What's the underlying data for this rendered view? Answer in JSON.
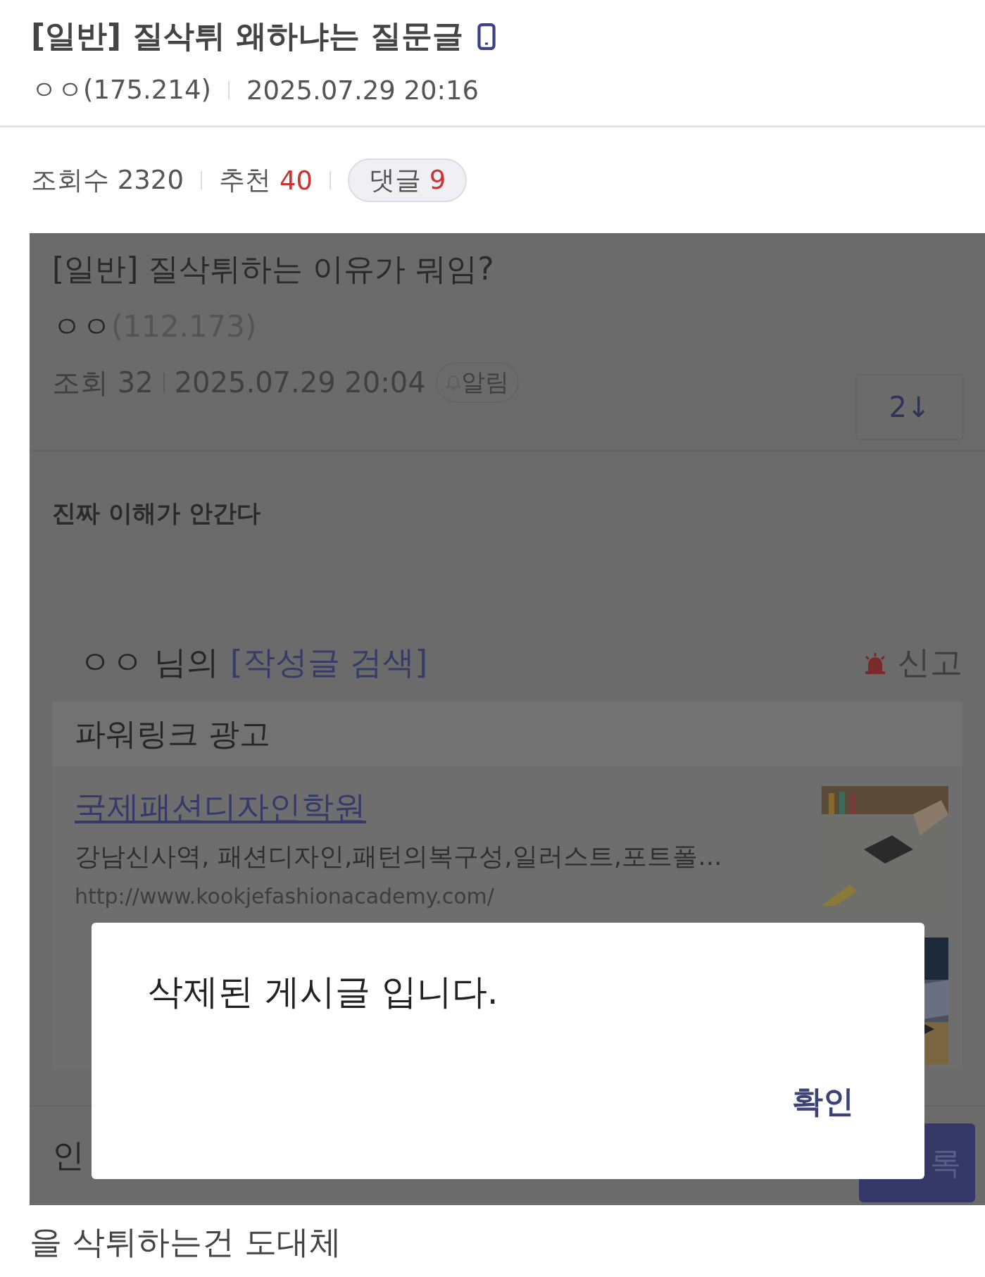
{
  "post": {
    "title": "[일반] 질삭튀 왜하냐는 질문글",
    "author": "ㅇㅇ(175.214)",
    "date": "2025.07.29 20:16"
  },
  "stats": {
    "views_label": "조회수",
    "views": "2320",
    "recommend_label": "추천",
    "recommend": "40",
    "comments_label": "댓글",
    "comments": "9"
  },
  "screenshot": {
    "title": "[일반] 질삭튀하는 이유가 뭐임?",
    "author": "ㅇㅇ",
    "ip": "(112.173)",
    "views": "조회 32",
    "date": "2025.07.29 20:04",
    "alert": "알림",
    "jump": "2↓",
    "body": "진짜 이해가 안간다",
    "author_line": {
      "name": "ㅇㅇ 님의",
      "link": "[작성글 검색]",
      "report": "신고"
    },
    "ad_header": "파워링크 광고",
    "ads": [
      {
        "title": "국제패션디자인학원",
        "desc": "강남신사역, 패션디자인,패턴의복구성,일러스트,포트폴...",
        "url": "http://www.kookjefashionacademy.com/"
      },
      {
        "kind": "picture"
      }
    ],
    "comment_input": "인",
    "submit": "록",
    "dialog": {
      "message": "삭제된 게시글 입니다.",
      "confirm": "확인"
    }
  },
  "caption": "을 삭튀하는건 도대체"
}
